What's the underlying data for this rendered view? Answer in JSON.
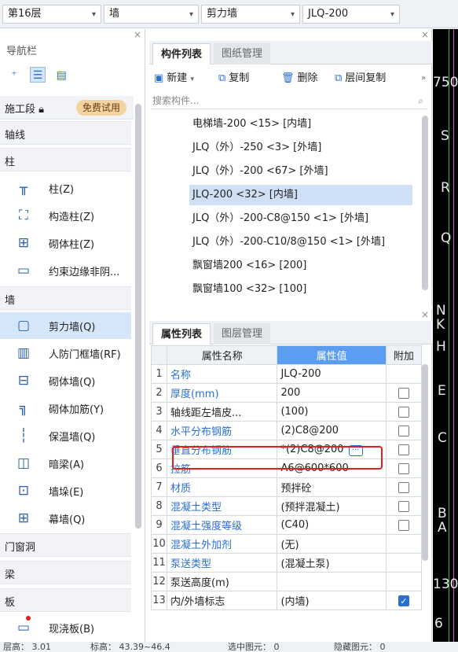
{
  "top_bar": {
    "floor": "第16层",
    "category": "墙",
    "type": "剪力墙",
    "component": "JLQ-200"
  },
  "nav": {
    "title": "导航栏",
    "phase_label": "施工段",
    "trial_badge": "免费试用",
    "categories": {
      "axis": "轴线",
      "column": "柱",
      "wall": "墙",
      "door_window": "门窗洞",
      "beam": "梁",
      "slab": "板"
    },
    "items": {
      "column": "柱(Z)",
      "struct_column": "构造柱(Z)",
      "masonry_column": "砌体柱(Z)",
      "edge_member": "约束边缘非阴...",
      "shear_wall": "剪力墙(Q)",
      "civil_defense_wall": "人防门框墙(RF)",
      "masonry_wall": "砌体墙(Q)",
      "masonry_rebar": "砌体加筋(Y)",
      "insulation_wall": "保温墙(Q)",
      "hidden_beam": "暗梁(A)",
      "wall_pier": "墙垛(E)",
      "curtain_wall": "幕墙(Q)",
      "cast_slab": "现浇板(B)"
    }
  },
  "component_panel": {
    "tab_list": "构件列表",
    "tab_drawing": "图纸管理",
    "toolbar": {
      "new": "新建",
      "copy": "复制",
      "delete": "删除",
      "floor_copy": "层间复制"
    },
    "search_placeholder": "搜索构件...",
    "items": [
      "电梯墙-200 <15> [内墙]",
      "JLQ（外）-250 <3> [外墙]",
      "JLQ（外）-200 <67> [外墙]",
      "JLQ-200 <32> [内墙]",
      "JLQ（外）-200-C8@150 <1> [外墙]",
      "JLQ（外）-200-C10/8@150 <1> [外墙]",
      "飘窗墙200 <16> [200]",
      "飘窗墙100 <32> [100]"
    ]
  },
  "properties_panel": {
    "tab_props": "属性列表",
    "tab_layers": "图层管理",
    "header": {
      "name": "属性名称",
      "value": "属性值",
      "extra": "附加"
    },
    "rows": [
      {
        "n": "1",
        "name": "名称",
        "value": "JLQ-200"
      },
      {
        "n": "2",
        "name": "厚度(mm)",
        "value": "200"
      },
      {
        "n": "3",
        "name": "轴线距左墙皮...",
        "value": "(100)"
      },
      {
        "n": "4",
        "name": "水平分布钢筋",
        "value": "(2)C8@200"
      },
      {
        "n": "5",
        "name": "垂直分布钢筋",
        "value": "*(2)C8@200"
      },
      {
        "n": "6",
        "name": "拉筋",
        "value": "A6@600*600"
      },
      {
        "n": "7",
        "name": "材质",
        "value": "预拌砼"
      },
      {
        "n": "8",
        "name": "混凝土类型",
        "value": "(预拌混凝土)"
      },
      {
        "n": "9",
        "name": "混凝土强度等级",
        "value": "(C40)"
      },
      {
        "n": "10",
        "name": "混凝土外加剂",
        "value": "(无)"
      },
      {
        "n": "11",
        "name": "泵送类型",
        "value": "(混凝土泵)"
      },
      {
        "n": "12",
        "name": "泵送高度(m)",
        "value": ""
      },
      {
        "n": "13",
        "name": "内/外墙标志",
        "value": "(内墙)"
      }
    ]
  },
  "canvas": {
    "labels": [
      "750",
      "S",
      "R",
      "Q",
      "N",
      "K",
      "H",
      "E",
      "C",
      "B",
      "A",
      "130",
      "6"
    ]
  },
  "status_bar": {
    "floor_height": "层高： 3.01",
    "elevation": "标高： 43.39~46.4",
    "selected": "选中图元： 0",
    "hidden": "隐藏图元： 0"
  }
}
